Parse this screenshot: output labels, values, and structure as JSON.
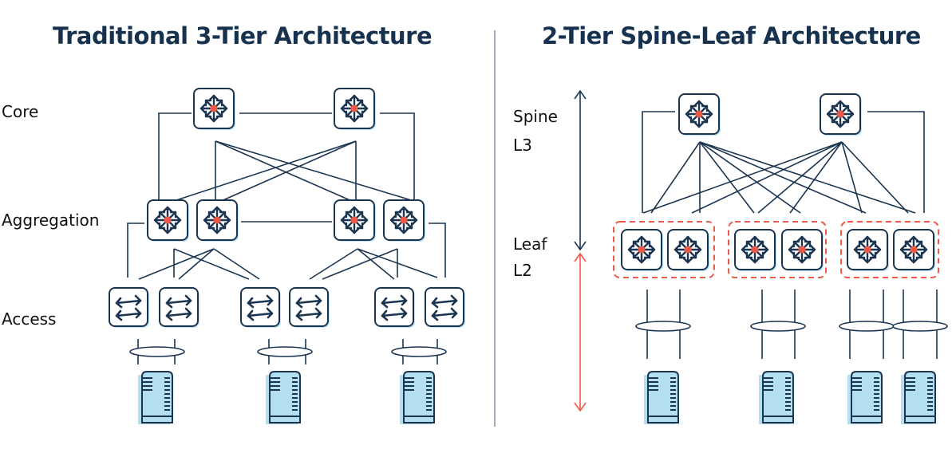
{
  "left_panel": {
    "title": "Traditional 3-Tier Architecture",
    "tiers": [
      "Core",
      "Aggregation",
      "Access"
    ]
  },
  "right_panel": {
    "title": "2-Tier Spine-Leaf Architecture",
    "tiers": [
      {
        "name": "Spine",
        "layer": "L3"
      },
      {
        "name": "Leaf",
        "layer": "L2"
      }
    ]
  },
  "icons": {
    "router": "router-icon",
    "switch": "switch-icon",
    "server": "server-icon",
    "link_bundle": "link-bundle-icon"
  },
  "colors": {
    "title": "#16324f",
    "line": "#1b3550",
    "accent_red": "#ee5a47",
    "device_fill": "#cde8f4",
    "server_fill": "#b3dff0",
    "divider": "#8a9aa8"
  }
}
